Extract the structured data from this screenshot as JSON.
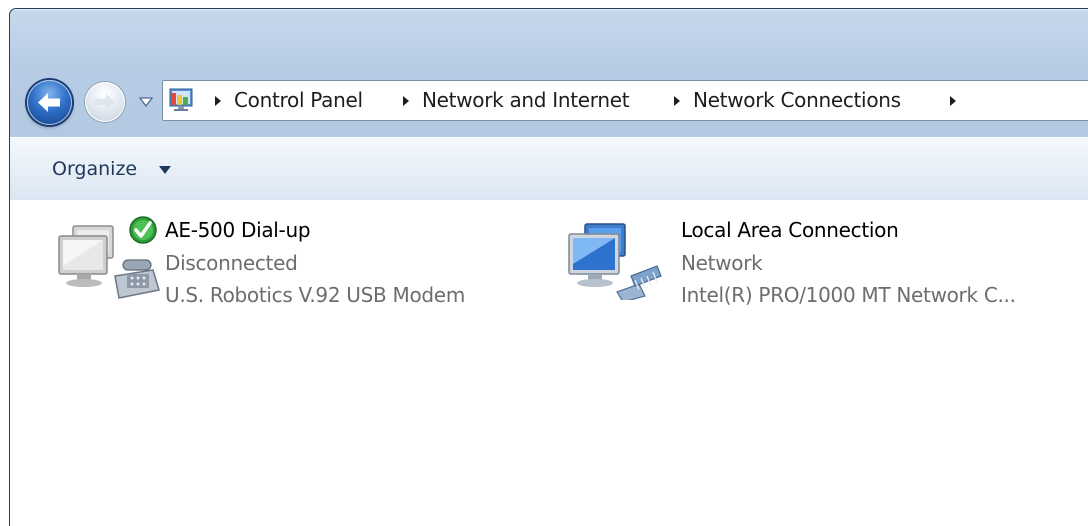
{
  "breadcrumb": {
    "items": [
      "Control Panel",
      "Network and Internet",
      "Network Connections"
    ]
  },
  "toolbar": {
    "organize_label": "Organize"
  },
  "connections": [
    {
      "name": "AE-500 Dial-up",
      "status": "Disconnected",
      "device": "U.S. Robotics V.92 USB Modem",
      "icon": "dialup-modem-icon"
    },
    {
      "name": "Local Area Connection",
      "status": "Network",
      "device": "Intel(R) PRO/1000 MT Network C...",
      "icon": "lan-network-icon"
    }
  ],
  "colors": {
    "title_bar": "#b7cce4",
    "command_bar": "#e9f0f8",
    "secondary_text": "#6d6d6d",
    "organize_text": "#1e395b"
  }
}
